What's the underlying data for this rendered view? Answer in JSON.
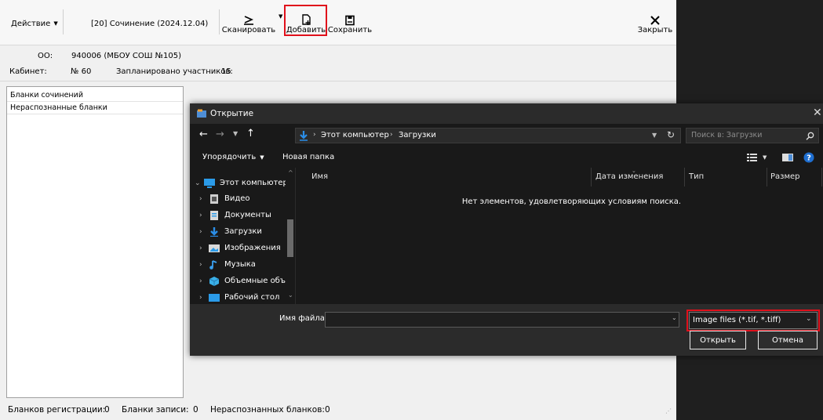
{
  "toolbar": {
    "action_label": "Действие",
    "document_title": "[20] Сочинение (2024.12.04)",
    "scan_label": "Сканировать",
    "add_label": "Добавить",
    "save_label": "Сохранить",
    "close_label": "Закрыть"
  },
  "info": {
    "org_label": "ОО:",
    "org_value": "940006 (МБОУ СОШ №105)",
    "room_label": "Кабинет:",
    "room_value": "№ 60",
    "planned_label": "Запланировано участников:",
    "planned_value": "15"
  },
  "tree": {
    "items": [
      {
        "label": "Бланки сочинений"
      },
      {
        "label": "Нераспознанные бланки"
      }
    ]
  },
  "status": {
    "reg_label": "Бланков регистрации:",
    "reg_value": "0",
    "rec_label": "Бланки записи:",
    "rec_value": "0",
    "unrec_label": "Нераспознанных бланков:",
    "unrec_value": "0"
  },
  "dialog": {
    "title": "Открытие",
    "path": {
      "root": "Этот компьютер",
      "current": "Загрузки"
    },
    "search_placeholder": "Поиск в: Загрузки",
    "organize_label": "Упорядочить",
    "new_folder_label": "Новая папка",
    "columns": {
      "name": "Имя",
      "date": "Дата изменения",
      "type": "Тип",
      "size": "Размер"
    },
    "empty_message": "Нет элементов, удовлетворяющих условиям поиска.",
    "nav_items": [
      {
        "label": "Этот компьютер",
        "icon": "computer-icon"
      },
      {
        "label": "Видео",
        "icon": "video-icon"
      },
      {
        "label": "Документы",
        "icon": "documents-icon"
      },
      {
        "label": "Загрузки",
        "icon": "downloads-icon"
      },
      {
        "label": "Изображения",
        "icon": "pictures-icon"
      },
      {
        "label": "Музыка",
        "icon": "music-icon"
      },
      {
        "label": "Объемные объ",
        "icon": "3d-objects-icon"
      },
      {
        "label": "Рабочий стол",
        "icon": "desktop-icon"
      }
    ],
    "filename_label": "Имя файла:",
    "filename_value": "",
    "filter_value": "Image files (*.tif, *.tiff)",
    "open_label": "Открыть",
    "cancel_label": "Отмена"
  },
  "colors": {
    "highlight": "#e0101b",
    "accent": "#0a84d6"
  }
}
